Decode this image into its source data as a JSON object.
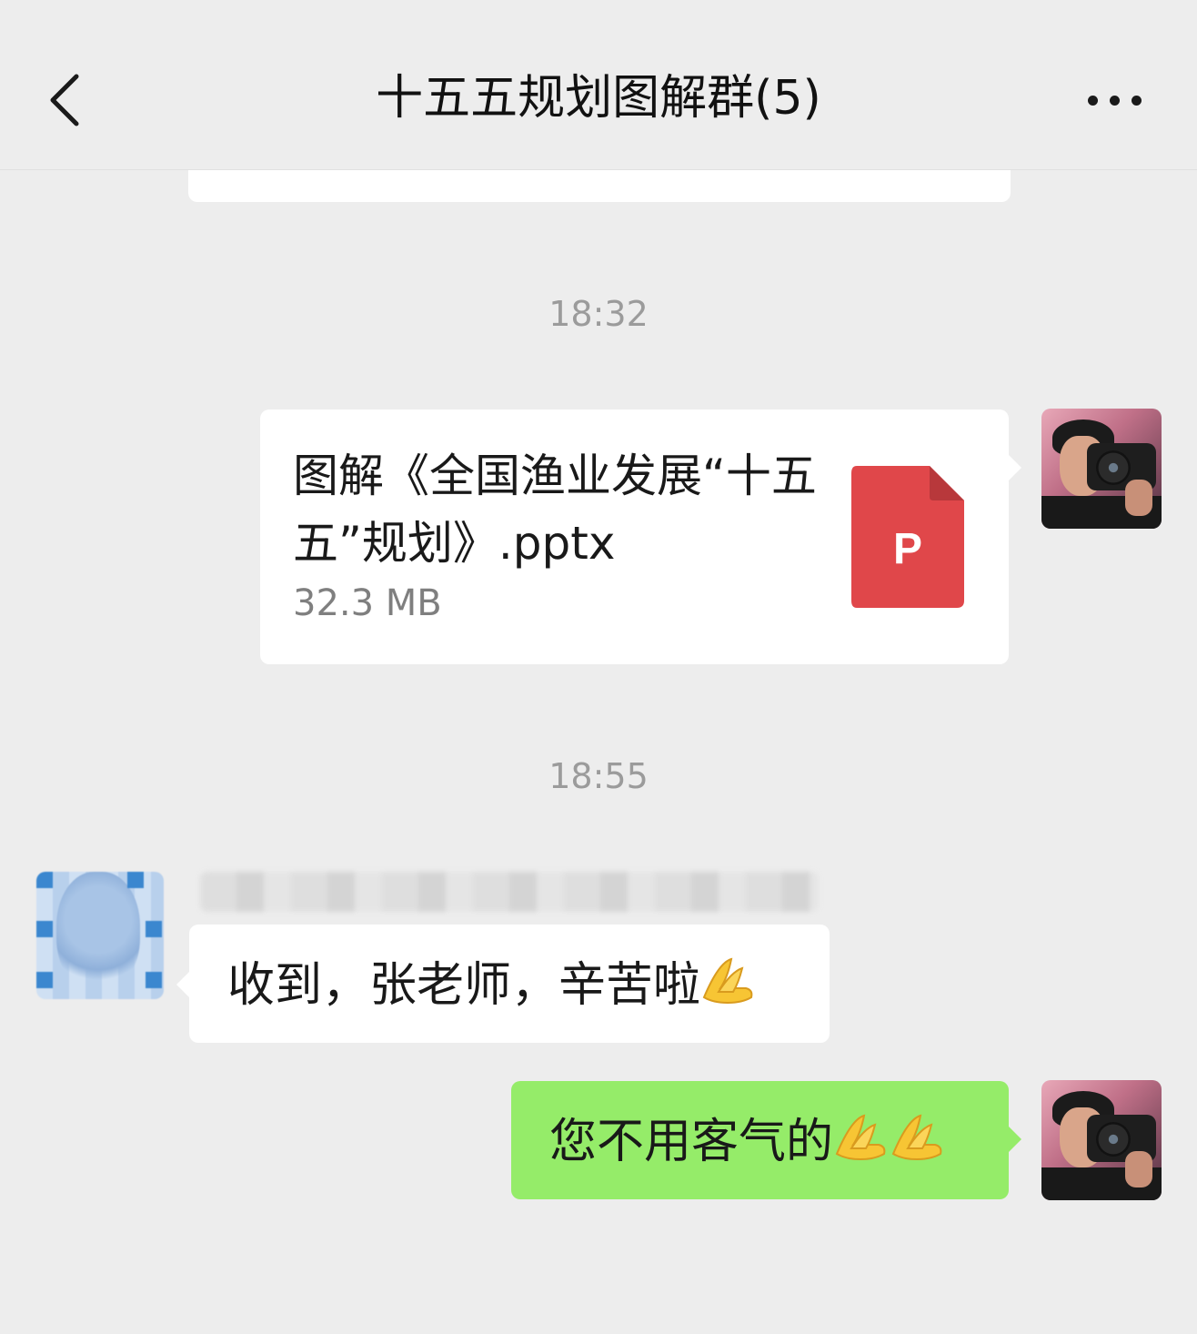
{
  "header": {
    "title": "十五五规划图解群(5)"
  },
  "icons": {
    "back": "chevron-left-icon",
    "more": "ellipsis-icon",
    "file": "pptx-file-icon",
    "emoji": "pray-hands-emoji"
  },
  "messages": [
    {
      "timestamp": "18:32",
      "sender": "me",
      "type": "file",
      "file_name": "图解《全国渔业发展“十五五”规划》.pptx",
      "file_size": "32.3 MB",
      "file_badge": "P"
    },
    {
      "timestamp": "18:55",
      "sender": "other",
      "type": "text",
      "text": "收到，张老师，辛苦啦",
      "emoji_count": 1
    },
    {
      "sender": "me",
      "type": "text",
      "text": "您不用客气的",
      "emoji_count": 2
    }
  ],
  "colors": {
    "background": "#ededed",
    "bubble_self": "#95ec69",
    "bubble_other": "#ffffff",
    "pptx_red": "#e0474a",
    "timestamp": "#9b9b9b"
  }
}
